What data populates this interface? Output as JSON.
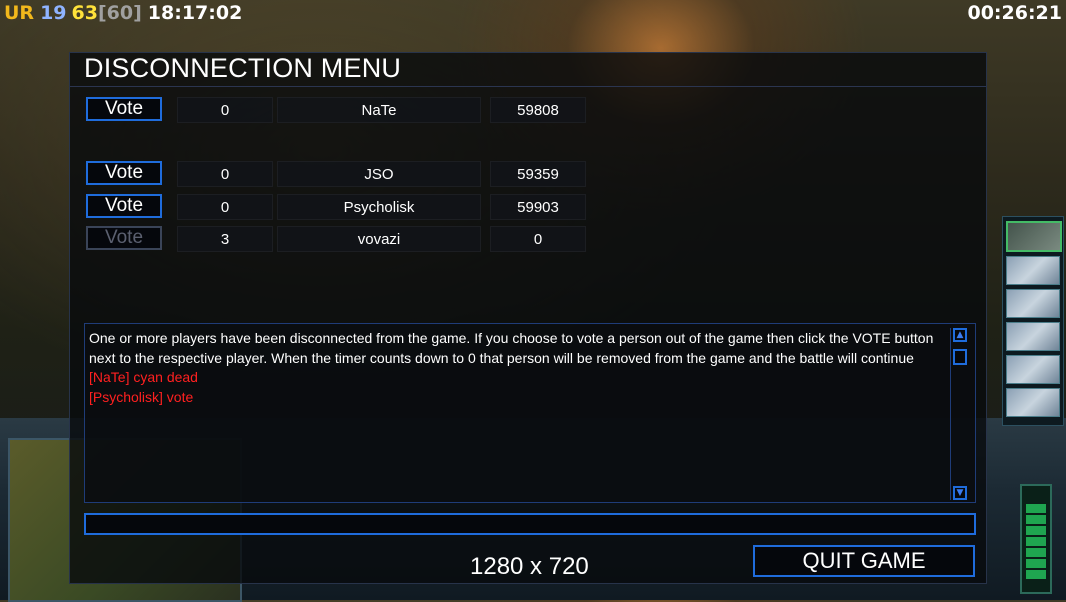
{
  "hud": {
    "faction": "UR",
    "stat1": "19",
    "stat2": "63",
    "stat3": "[60]",
    "local_time": "18:17:02",
    "game_timer": "00:26:21",
    "colors": {
      "faction": "#f2b81c",
      "stat1": "#8fb3ff",
      "stat2": "#ffe23a",
      "stat3": "#a0a0a0"
    }
  },
  "dialog": {
    "title": "DISCONNECTION MENU",
    "players": [
      {
        "vote_label": "Vote",
        "votes": "0",
        "name": "NaTe",
        "ping": "59808",
        "enabled": true
      },
      {
        "vote_label": "Vote",
        "votes": "0",
        "name": "JSO",
        "ping": "59359",
        "enabled": true
      },
      {
        "vote_label": "Vote",
        "votes": "0",
        "name": "Psycholisk",
        "ping": "59903",
        "enabled": true
      },
      {
        "vote_label": "Vote",
        "votes": "3",
        "name": "vovazi",
        "ping": "0",
        "enabled": false
      }
    ],
    "messages": {
      "info": "One or more players have been disconnected from the game. If you choose to vote a person out of the game then click the VOTE button next to the respective player. When the timer counts down to 0 that person will be removed from the game and the battle will continue",
      "line1": "[NaTe] cyan dead",
      "line2": "[Psycholisk] vote"
    },
    "resolution": "1280 x 720",
    "quit_label": "QUIT GAME"
  },
  "colors": {
    "accent": "#1f6cdc",
    "chat_alert": "#ff2020"
  }
}
